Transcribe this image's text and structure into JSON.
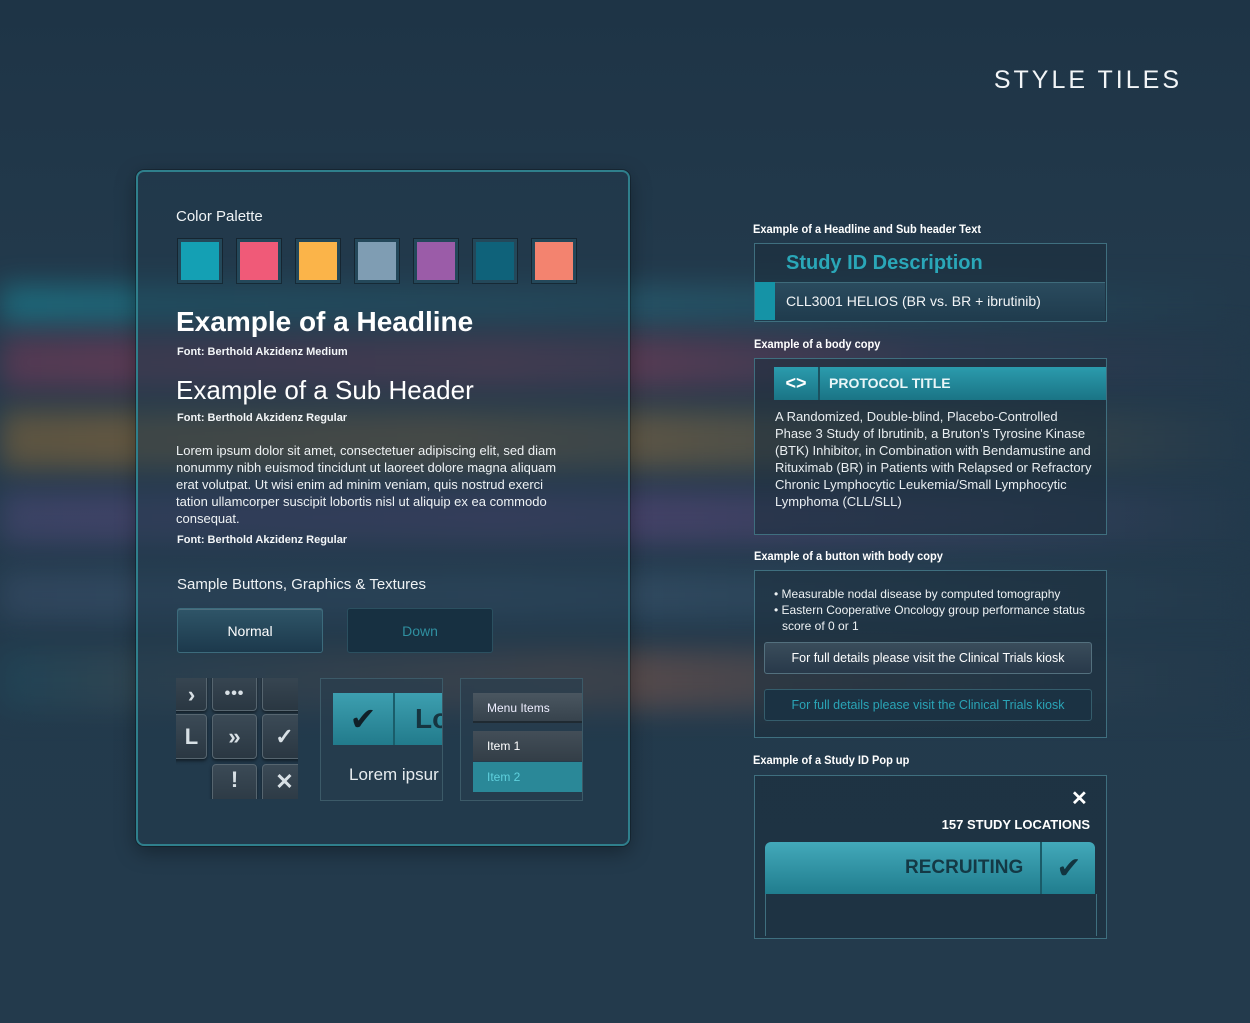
{
  "page_title": "STYLE TILES",
  "palette": {
    "title": "Color Palette",
    "colors": [
      "#14a0b4",
      "#f05a78",
      "#fbb449",
      "#7f9db3",
      "#9b5ca8",
      "#0f627a",
      "#f3836f"
    ]
  },
  "typography": {
    "headline": "Example of a Headline",
    "headline_font": "Font: Berthold Akzidenz Medium",
    "subheader": "Example of a Sub Header",
    "subheader_font": "Font: Berthold Akzidenz Regular",
    "body": "Lorem ipsum dolor sit amet, consectetuer adipiscing elit, sed diam nonummy nibh euismod tincidunt ut laoreet dolore magna aliquam erat volutpat. Ut wisi enim ad minim veniam, quis nostrud exerci tation ullamcorper suscipit lobortis nisl ut aliquip ex ea commodo consequat.",
    "body_font": "Font: Berthold Akzidenz Regular"
  },
  "samples": {
    "title": "Sample Buttons, Graphics & Textures",
    "normal_button": "Normal",
    "down_button": "Down",
    "checkbox_label": "Lo",
    "checkbox_text": "Lorem ipsur",
    "menu_header": "Menu Items",
    "menu_items": [
      "Item 1",
      "Item 2"
    ]
  },
  "headline_example": {
    "section": "Example of a Headline and Sub header Text",
    "title": "Study ID Description",
    "subtitle": "CLL3001 HELIOS  (BR vs. BR + ibrutinib)"
  },
  "body_example": {
    "section": "Example of a body copy",
    "title": "PROTOCOL TITLE",
    "body": "A Randomized, Double-blind, Placebo-Controlled Phase 3 Study of Ibrutinib, a Bruton's Tyrosine Kinase (BTK) Inhibitor, in Combination with Bendamustine and Rituximab (BR) in Patients with Relapsed or Refractory Chronic Lymphocytic Leukemia/Small Lymphocytic Lymphoma (CLL/SLL)"
  },
  "button_example": {
    "section": "Example of a button with body copy",
    "bullet1": "Measurable nodal disease by computed tomography",
    "bullet2": "Eastern Cooperative Oncology group performance status score of 0 or 1",
    "button_normal": "For full details please visit the Clinical Trials kiosk",
    "button_down": "For full details please visit the Clinical Trials kiosk"
  },
  "popup_example": {
    "section": "Example of a Study ID Pop up",
    "locations": "157 STUDY LOCATIONS",
    "status": "RECRUITING"
  }
}
